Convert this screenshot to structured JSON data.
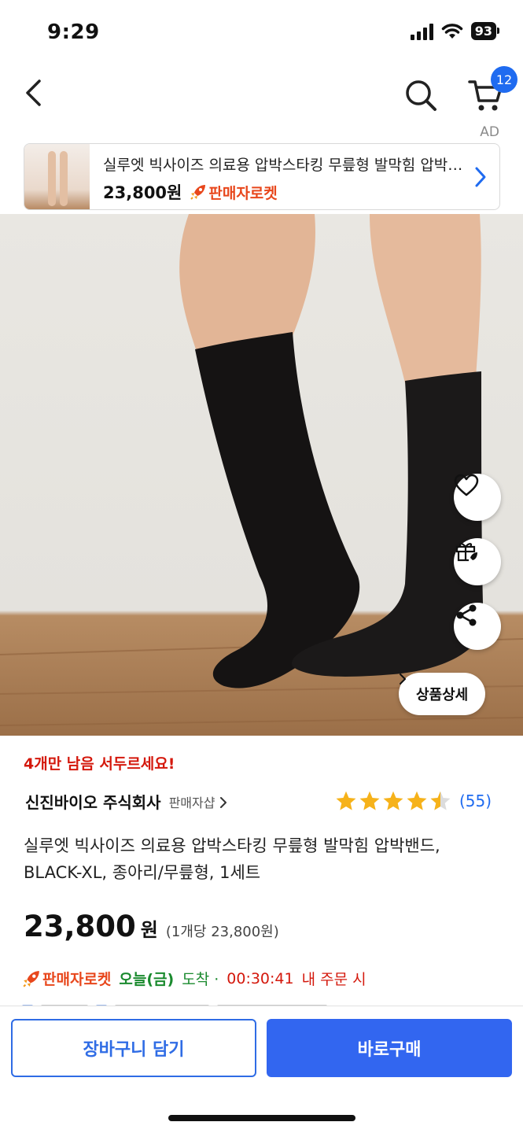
{
  "status_bar": {
    "time": "9:29",
    "battery": "93"
  },
  "nav": {
    "cart_count": "12"
  },
  "ad": {
    "label": "AD",
    "title": "실루엣 빅사이즈 의료용 압박스타킹 무릎형 발막힘 압박밴드",
    "price": "23,800원",
    "badge": "판매자로켓"
  },
  "hero": {
    "detail_button_label": "상품상세"
  },
  "product": {
    "urgency": "4개만 남음 서두르세요!",
    "seller_name": "신진바이오 주식회사",
    "seller_link": "판매자샵",
    "rating": 4.5,
    "review_count": "(55)",
    "title": "실루엣 빅사이즈 의료용 압박스타킹 무릎형 발막힘 압박밴드, BLACK-XL, 종아리/무릎형, 1세트",
    "price": "23,800",
    "price_unit": "원",
    "unit_price": "(1개당 23,800원)"
  },
  "delivery": {
    "badge": "판매자로켓",
    "day": "오늘(금)",
    "arrive": "도착 ·",
    "countdown": "00:30:41",
    "order_note": "내 주문 시"
  },
  "actions": {
    "add_to_cart": "장바구니 담기",
    "buy_now": "바로구매"
  },
  "colors": {
    "accent": "#3266f0",
    "rocket": "#e8471c",
    "urgent": "#d4180c",
    "delivery": "#1a8a2e",
    "star": "#f6b21a"
  }
}
